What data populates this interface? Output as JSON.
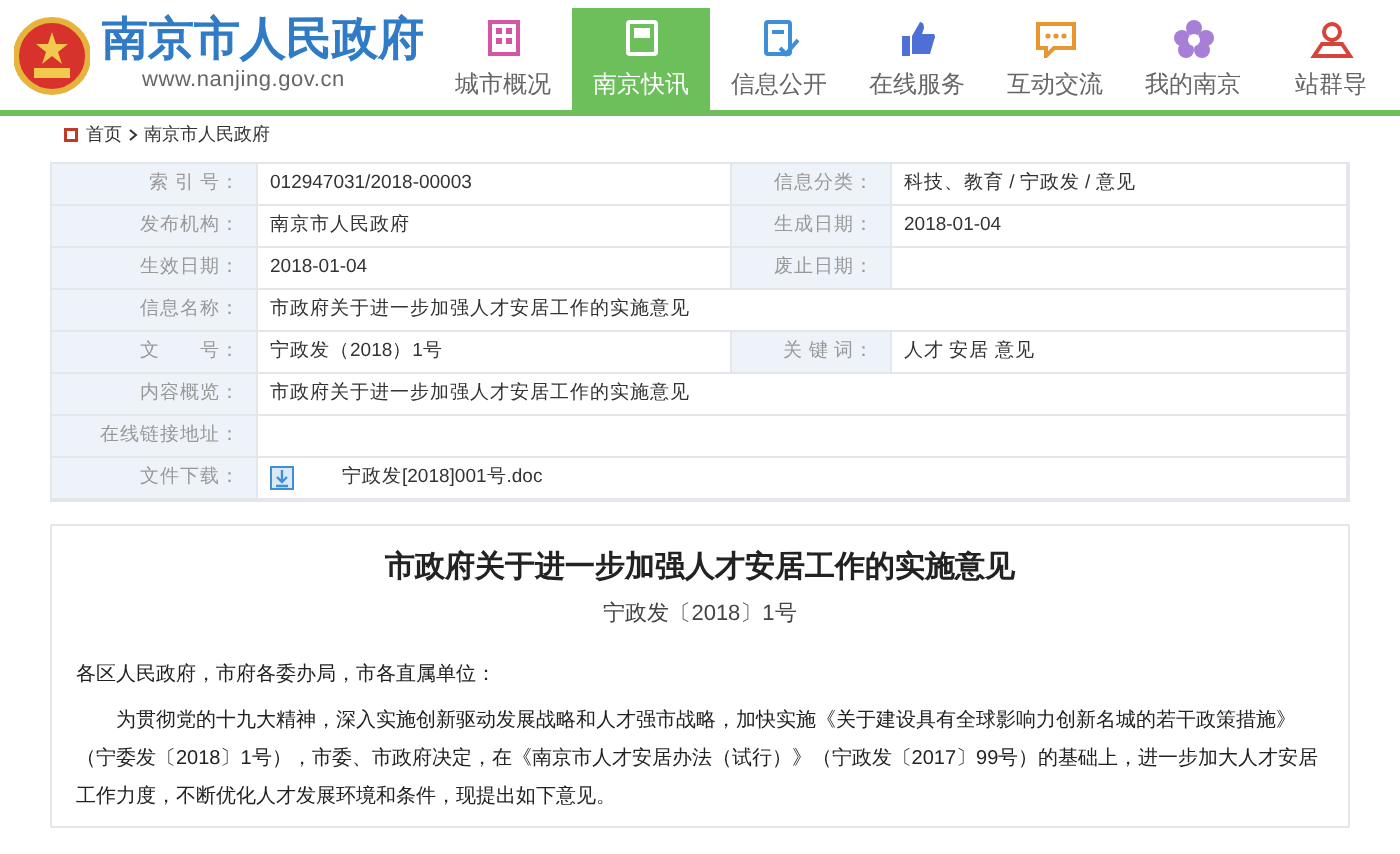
{
  "site": {
    "title": "南京市人民政府",
    "url": "www.nanjing.gov.cn"
  },
  "nav": [
    {
      "label": "城市概况",
      "selected": false
    },
    {
      "label": "南京快讯",
      "selected": true
    },
    {
      "label": "信息公开",
      "selected": false
    },
    {
      "label": "在线服务",
      "selected": false
    },
    {
      "label": "互动交流",
      "selected": false
    },
    {
      "label": "我的南京",
      "selected": false
    },
    {
      "label": "站群导",
      "selected": false
    }
  ],
  "breadcrumb": [
    "首页",
    "南京市人民政府"
  ],
  "info_table": [
    {
      "kind": "pair",
      "label": "索 引 号：",
      "value": "012947031/2018-00003",
      "label_2": "信息分类：",
      "value_2": "科技、教育 / 宁政发 / 意见"
    },
    {
      "kind": "pair",
      "label": "发布机构：",
      "value": "南京市人民政府",
      "label_2": "生成日期：",
      "value_2": "2018-01-04"
    },
    {
      "kind": "pair",
      "label": "生效日期：",
      "value": "2018-01-04",
      "label_2": "废止日期："
    },
    {
      "kind": "wide",
      "label": "信息名称：",
      "value": "市政府关于进一步加强人才安居工作的实施意见"
    },
    {
      "kind": "pair",
      "label": "文　　号：",
      "value": "宁政发（2018）1号",
      "label_2": "关 键 词：",
      "value_2": "人才 安居 意见"
    },
    {
      "kind": "wide",
      "label": "内容概览：",
      "value": "市政府关于进一步加强人才安居工作的实施意见"
    },
    {
      "kind": "wide",
      "label": "在线链接地址："
    },
    {
      "kind": "download",
      "label": "文件下载：",
      "value": "宁政发[2018]001号.doc"
    }
  ],
  "article": {
    "title": "市政府关于进一步加强人才安居工作的实施意见",
    "doc_number": "宁政发〔2018〕1号",
    "paragraphs": [
      {
        "text": "各区人民政府，市府各委办局，市各直属单位：",
        "indent": false
      },
      {
        "text": "为贯彻党的十九大精神，深入实施创新驱动发展战略和人才强市战略，加快实施《关于建设具有全球影响力创新名城的若干政策措施》（宁委发〔2018〕1号），市委、市政府决定，在《南京市人才安居办法（试行）》（宁政发〔2017〕99号）的基础上，进一步加大人才安居工作力度，不断优化人才发展环境和条件，现提出如下意见。",
        "indent": true
      }
    ]
  }
}
